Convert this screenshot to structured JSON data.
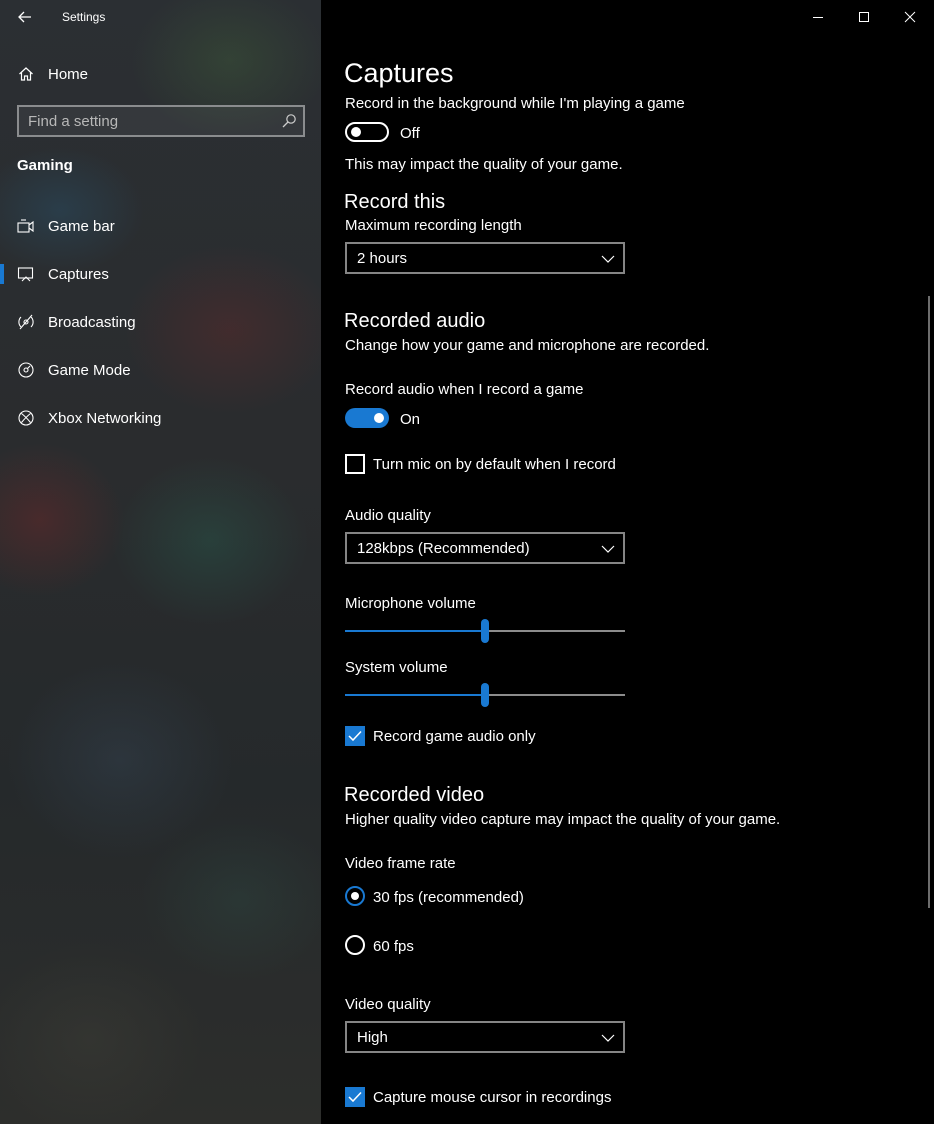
{
  "window": {
    "title": "Settings"
  },
  "sidebar": {
    "home_label": "Home",
    "search_placeholder": "Find a setting",
    "section": "Gaming",
    "items": [
      {
        "label": "Game bar",
        "icon": "game-bar-icon"
      },
      {
        "label": "Captures",
        "icon": "captures-icon",
        "selected": true
      },
      {
        "label": "Broadcasting",
        "icon": "broadcasting-icon"
      },
      {
        "label": "Game Mode",
        "icon": "game-mode-icon"
      },
      {
        "label": "Xbox Networking",
        "icon": "xbox-icon"
      }
    ]
  },
  "main": {
    "page_title": "Captures",
    "background_recording": {
      "label": "Record in the background while I'm playing a game",
      "state": "Off",
      "note": "This may impact the quality of your game."
    },
    "record_this": {
      "heading": "Record this",
      "max_length_label": "Maximum recording length",
      "max_length_value": "2 hours"
    },
    "recorded_audio": {
      "heading": "Recorded audio",
      "description": "Change how your game and microphone are recorded.",
      "record_audio_label": "Record audio when I record a game",
      "record_audio_state": "On",
      "mic_default_label": "Turn mic on by default when I record",
      "audio_quality_label": "Audio quality",
      "audio_quality_value": "128kbps (Recommended)",
      "mic_volume_label": "Microphone volume",
      "mic_volume_level": 0.5,
      "system_volume_label": "System volume",
      "system_volume_level": 0.5,
      "game_audio_only_label": "Record game audio only"
    },
    "recorded_video": {
      "heading": "Recorded video",
      "description": "Higher quality video capture may impact the quality of your game.",
      "frame_rate_label": "Video frame rate",
      "fps30_label": "30 fps (recommended)",
      "fps60_label": "60 fps",
      "quality_label": "Video quality",
      "quality_value": "High",
      "mouse_cursor_label": "Capture mouse cursor in recordings"
    }
  },
  "colors": {
    "accent": "#1979d2",
    "background": "#000000"
  }
}
